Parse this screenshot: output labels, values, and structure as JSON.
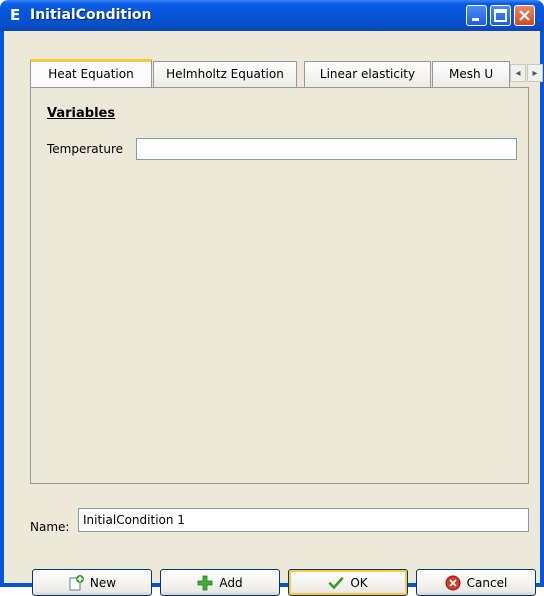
{
  "window": {
    "title": "InitialCondition",
    "app_icon_letter": "E"
  },
  "tabs": [
    {
      "label": "Heat Equation",
      "active": true
    },
    {
      "label": "Helmholtz Equation",
      "active": false
    },
    {
      "label": "Linear elasticity",
      "active": false
    },
    {
      "label": "Mesh U",
      "active": false
    }
  ],
  "panel": {
    "section_title": "Variables",
    "fields": [
      {
        "label": "Temperature",
        "value": ""
      }
    ]
  },
  "name_field": {
    "label": "Name:",
    "value": "InitialCondition 1"
  },
  "buttons": {
    "new": "New",
    "add": "Add",
    "ok": "OK",
    "cancel": "Cancel"
  },
  "colors": {
    "title_bar": "#0a5ce5",
    "dialog_bg": "#ece9d8",
    "focus_accent": "#ffc73c"
  }
}
